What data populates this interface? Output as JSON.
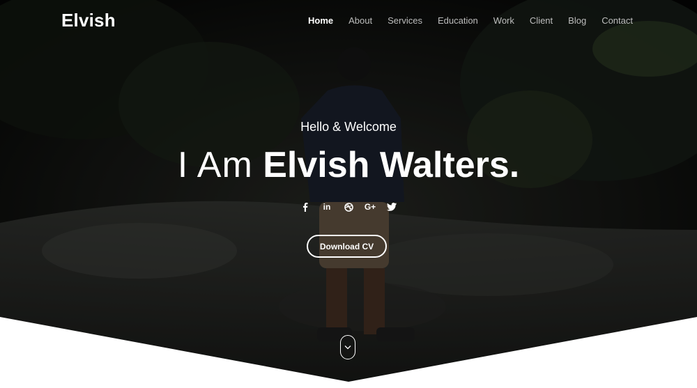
{
  "brand": {
    "name": "Elvish"
  },
  "nav": {
    "items": [
      {
        "label": "Home",
        "active": true
      },
      {
        "label": "About"
      },
      {
        "label": "Services"
      },
      {
        "label": "Education"
      },
      {
        "label": "Work"
      },
      {
        "label": "Client"
      },
      {
        "label": "Blog"
      },
      {
        "label": "Contact"
      }
    ]
  },
  "hero": {
    "greeting": "Hello & Welcome",
    "title_prefix": "I Am",
    "title_name": "Elvish Walters.",
    "cta_label": "Download CV"
  },
  "social": {
    "icons": [
      "facebook-icon",
      "linkedin-icon",
      "dribbble-icon",
      "google-plus-icon",
      "twitter-icon"
    ],
    "linkedin_text": "in",
    "gplus_text": "G+"
  },
  "colors": {
    "nav_active": "#ffffff",
    "nav_inactive": "#bdbdbd",
    "bottom_panel": "#ffffff",
    "background_photo": "#0b0d0b"
  },
  "scroll_hint": {
    "icon": "chevron-down-icon"
  }
}
